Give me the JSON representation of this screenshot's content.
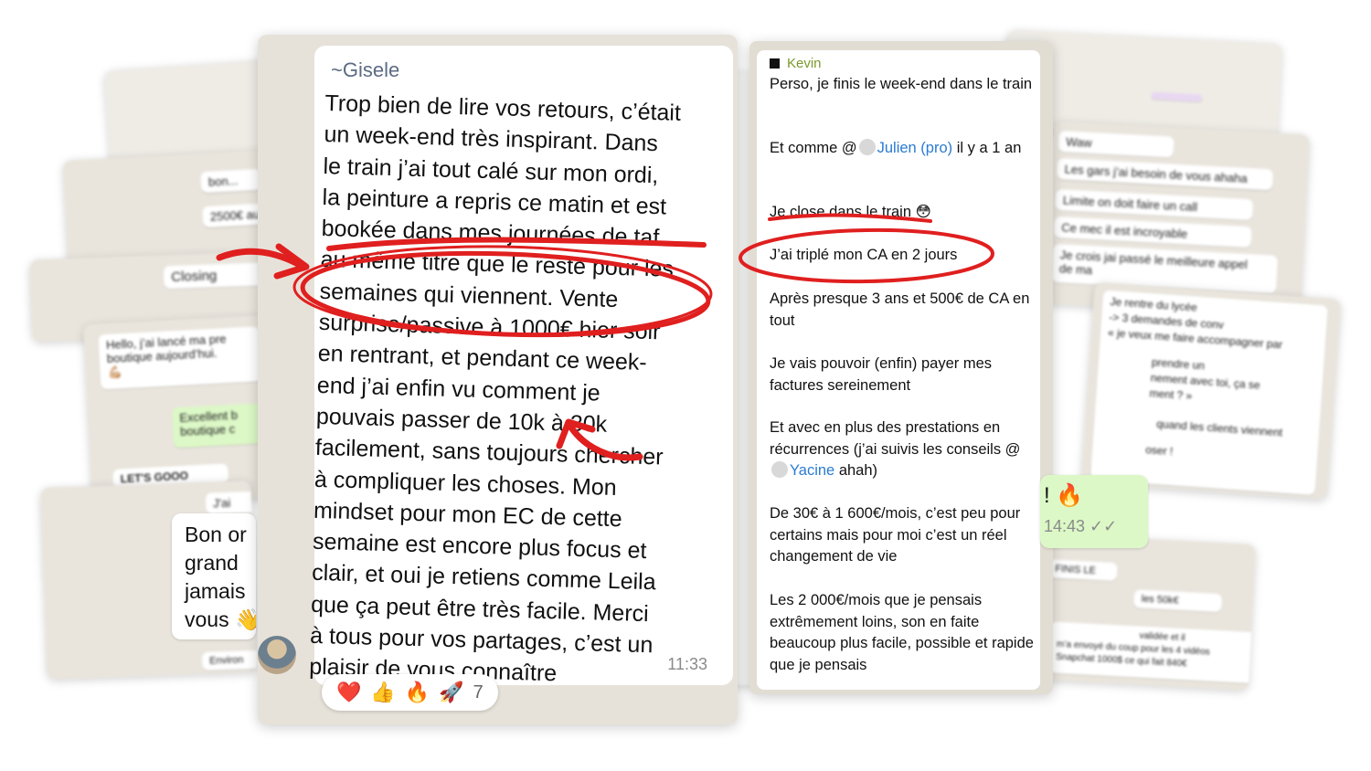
{
  "gisele": {
    "name": "~Gisele",
    "message_lines": [
      "Trop bien de lire vos retours, c’était",
      "un week-end très inspirant. Dans",
      "le train j’ai tout calé sur mon ordi,",
      "la peinture a repris ce matin et est",
      "bookée dans mes journées de taf",
      "au même titre que le reste pour les",
      "semaines qui viennent. Vente",
      "surprise/passive à 1000€ hier soir",
      "en rentrant, et pendant ce week-",
      "end j’ai enfin vu comment je",
      "pouvais passer de 10k à 30k",
      "facilement, sans toujours chercher",
      "à compliquer les choses. Mon",
      "mindset pour mon EC de cette",
      "semaine est encore plus focus et",
      "clair, et oui je retiens comme Leila",
      "que ça peut être très facile. Merci",
      "à tous pour vos partages, c’est un",
      "plaisir de vous connaître"
    ],
    "time": "11:33",
    "reactions": [
      "❤️",
      "👍",
      "🔥",
      "🚀"
    ],
    "reaction_count": "7"
  },
  "kevin": {
    "name": "Kevin",
    "p1": "Perso, je finis le week-end dans le train",
    "p2_before": "Et comme @",
    "p2_mention": "Julien (pro)",
    "p2_after": " il y a 1 an",
    "p3": "Je close dans le train 😳",
    "p4": "J’ai triplé mon CA en 2 jours",
    "p5": "Après presque 3 ans et 500€ de CA en tout",
    "p6": "Je vais pouvoir (enfin) payer mes factures sereinement",
    "p7_before": "Et avec en plus des prestations en récurrences (j’ai suivis les conseils @",
    "p7_mention": "Yacine",
    "p7_after": " ahah)",
    "p8": "De 30€ à 1 600€/mois, c’est peu pour certains mais pour moi c’est un réel changement de vie",
    "p9": "Les 2 000€/mois que je pensais extrêmement loins, son en faite beaucoup plus facile, possible et rapide que je pensais"
  },
  "right_green": {
    "text": "! 🔥",
    "time": "14:43 ✓✓"
  },
  "left_white_lines": [
    "Bon or",
    "grand",
    "jamais",
    "vous 👋"
  ],
  "bg_texts": {
    "hello_1": "Hello, j’ai lancé ma pre",
    "hello_2": "boutique aujourd’hui.",
    "excellent_1": "Excellent b",
    "excellent_2": "boutique c",
    "letsgo": "LET'S GOOO",
    "closing": "Closing",
    "bon": "bon...",
    "amount": "2500€ au",
    "environ": "Environ",
    "jai": "J'ai",
    "waw": "Waw",
    "gars": "Les gars j’ai besoin de vous ahaha",
    "limite": "Limite on doit faire un call",
    "mec": "Ce mec il est incroyable",
    "crois": "Je crois jai passé le meilleure appel",
    "dema": "de ma",
    "lycee_1": "Je rentre du lycée",
    "lycee_2": "-> 3 demandes de conv",
    "lycee_3": "« je veux me faire accompagner par",
    "prendre": "prendre un",
    "nement": "nement avec toi, ça se",
    "ment": "ment ? »",
    "quand": "quand les clients viennent",
    "oser": "oser !",
    "finis": "FINIS LE",
    "cinqk": "les 50k€",
    "valide_1": "validée et il",
    "valide_2": "m’a envoyé du coup pour les 4 vidéos",
    "valide_3": "Snapchat 1000$ ce qui fait 840€"
  }
}
